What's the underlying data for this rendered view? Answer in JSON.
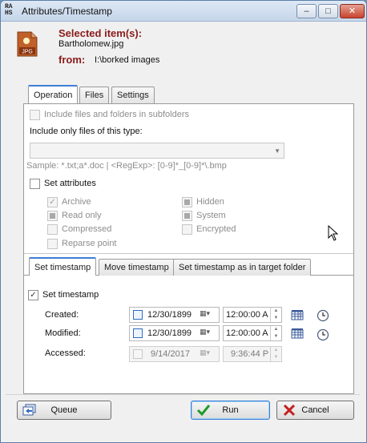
{
  "window": {
    "title": "Attributes/Timestamp",
    "logo_text": "RA HS",
    "minimize": "–",
    "maximize": "□",
    "close": "✕"
  },
  "header": {
    "selected_label": "Selected item(s):",
    "file_name": "Bartholomew.jpg",
    "file_icon_text": "JPG",
    "from_label": "from:",
    "from_path": "I:\\borked images"
  },
  "tabs": [
    "Operation",
    "Files",
    "Settings"
  ],
  "operation": {
    "include_subfolders": "Include files and folders in subfolders",
    "include_only_label": "Include only files of this type:",
    "file_type_value": "",
    "sample_text": "Sample: *.txt;a*.doc | <RegExp>: [0-9]*_[0-9]*\\.bmp",
    "set_attributes": "Set attributes",
    "attributes": [
      {
        "label": "Archive",
        "state": "checked"
      },
      {
        "label": "Hidden",
        "state": "indeterminate"
      },
      {
        "label": "Read only",
        "state": "indeterminate"
      },
      {
        "label": "System",
        "state": "indeterminate"
      },
      {
        "label": "Compressed",
        "state": "unchecked"
      },
      {
        "label": "Encrypted",
        "state": "unchecked"
      },
      {
        "label": "Reparse point",
        "state": "unchecked"
      }
    ]
  },
  "timestamp_tabs": [
    "Set timestamp",
    "Move timestamp",
    "Set timestamp as in target folder"
  ],
  "timestamp": {
    "set_timestamp": "Set timestamp",
    "rows": [
      {
        "label": "Created:",
        "date": "12/30/1899",
        "time": "12:00:00 A"
      },
      {
        "label": "Modified:",
        "date": "12/30/1899",
        "time": "12:00:00 A"
      },
      {
        "label": "Accessed:",
        "date": "9/14/2017",
        "time": "9:36:44 P"
      }
    ]
  },
  "buttons": {
    "queue": "Queue",
    "run": "Run",
    "cancel": "Cancel"
  },
  "colors": {
    "accent": "#3c7fd6",
    "label_red": "#8b1b1b"
  }
}
